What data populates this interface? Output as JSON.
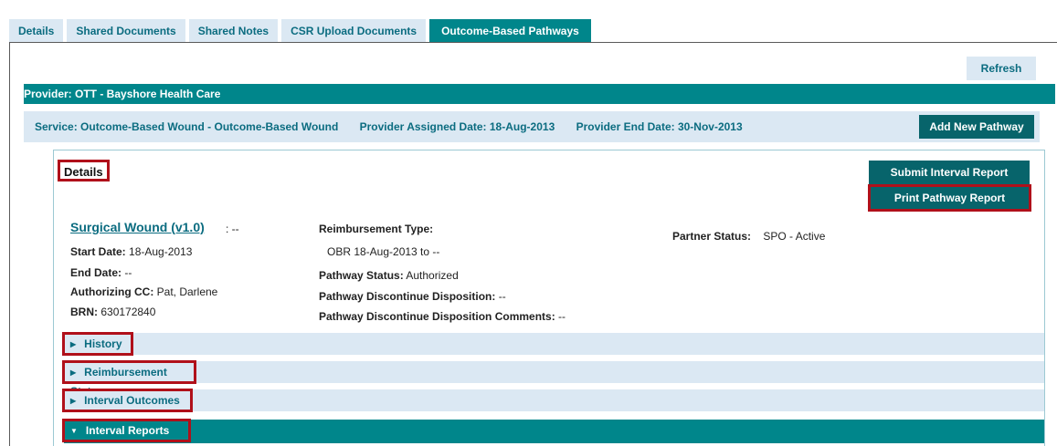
{
  "tabs": [
    "Details",
    "Shared Documents",
    "Shared Notes",
    "CSR Upload Documents",
    "Outcome-Based Pathways"
  ],
  "refresh_label": "Refresh",
  "provider_label": "Provider: OTT - Bayshore Health Care",
  "service": {
    "service": "Service: Outcome-Based Wound - Outcome-Based Wound",
    "assigned": "Provider Assigned Date: 18-Aug-2013",
    "end": "Provider End Date: 30-Nov-2013"
  },
  "add_pathway_label": "Add New Pathway",
  "details_heading": "Details",
  "submit_interval_label": "Submit Interval Report",
  "print_pathway_label": "Print Pathway Report",
  "pathway": {
    "name": "Surgical Wound (v1.0)",
    "name_suffix": ": --",
    "start_label": "Start Date:",
    "start_value": "18-Aug-2013",
    "end_label": "End Date:",
    "end_value": "--",
    "authorizing_label": "Authorizing CC:",
    "authorizing_value": "Pat, Darlene",
    "brn_label": "BRN:",
    "brn_value": "630172840",
    "reimbursement_label": "Reimbursement Type:",
    "reimbursement_value": "OBR 18-Aug-2013 to --",
    "status_label": "Pathway Status:",
    "status_value": "Authorized",
    "discontinue_label": "Pathway Discontinue Disposition:",
    "discontinue_value": "--",
    "discontinue_comments_label": "Pathway Discontinue Disposition Comments:",
    "discontinue_comments_value": "--",
    "partner_label": "Partner Status:",
    "partner_value": "SPO - Active"
  },
  "sections": {
    "history": "History",
    "reimbursement_status": "Reimbursement Status",
    "interval_outcomes": "Interval Outcomes",
    "interval_reports": "Interval Reports"
  },
  "colors": {
    "teal": "#00868b",
    "dark_teal": "#07646b",
    "light_blue": "#dbe8f3",
    "highlight_red": "#b0101a"
  }
}
